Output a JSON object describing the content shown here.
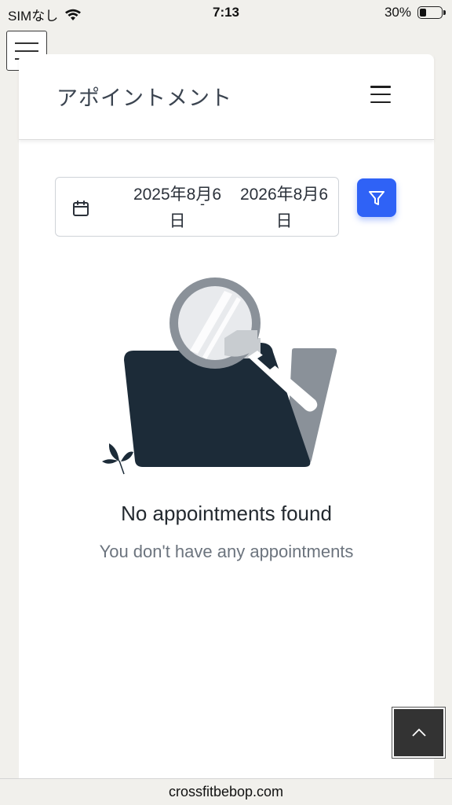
{
  "status_bar": {
    "carrier": "SIMなし",
    "time": "7:13",
    "battery": "30%",
    "battery_level": 0.3
  },
  "page": {
    "title": "アポイントメント"
  },
  "filters": {
    "date_start": "2025年8月6日",
    "date_separator": "-",
    "date_end": "2026年8月6日"
  },
  "empty_state": {
    "title": "No appointments found",
    "subtitle": "You don't have any appointments"
  },
  "browser": {
    "url": "crossfitbebop.com"
  },
  "colors": {
    "accent": "#2f62f6",
    "folder": "#1c2b38",
    "folder_back": "#8a9199"
  },
  "icons": {
    "outer_menu": "hamburger-icon",
    "header_menu": "hamburger-icon",
    "calendar": "calendar-icon",
    "filter": "filter-icon",
    "scroll_top": "chevron-up-icon",
    "wifi": "wifi-icon",
    "battery": "battery-icon"
  }
}
